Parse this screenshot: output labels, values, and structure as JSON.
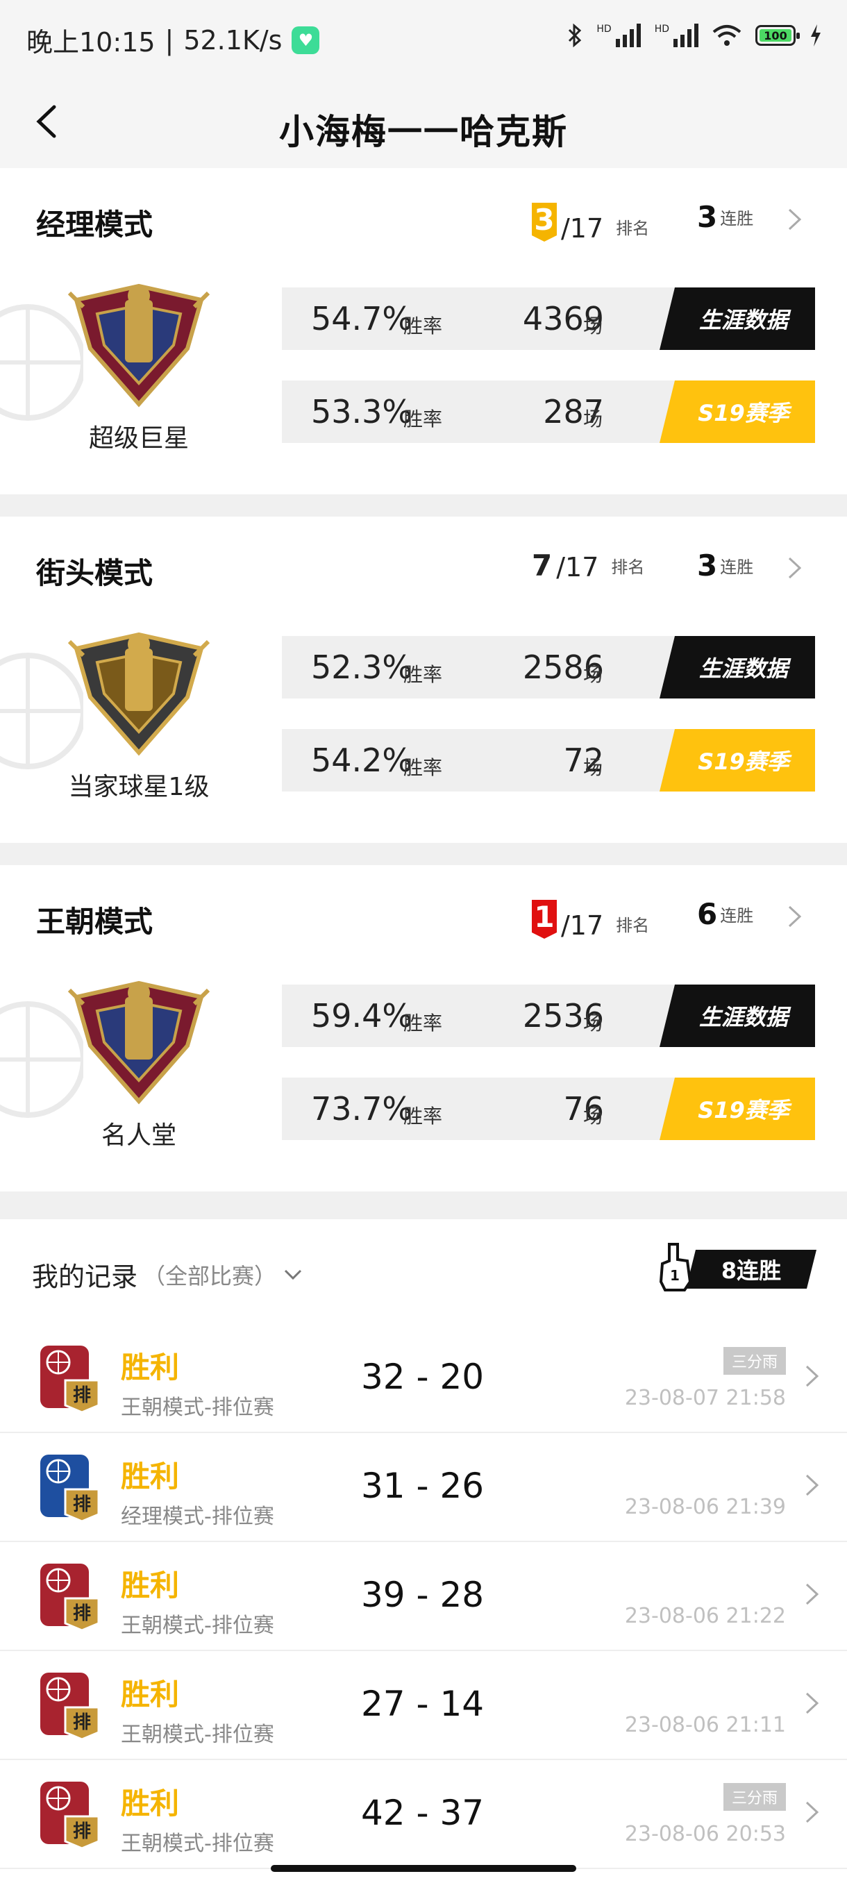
{
  "status_bar": {
    "time": "晚上10:15",
    "speed": "52.1K/s",
    "battery": "100"
  },
  "header": {
    "title": "小海梅一一哈克斯"
  },
  "modes": [
    {
      "title": "经理模式",
      "rank": "3",
      "rank_total": "/17",
      "rank_label": "排名",
      "rank_badge_color": "#f5b400",
      "streak": "3",
      "streak_label": "连胜",
      "emblem_name": "超级巨星",
      "rows": [
        {
          "pct": "54.7%",
          "pct_label": "胜率",
          "games": "4369",
          "games_label": "场",
          "tag": "生涯数据",
          "tag_style": "black"
        },
        {
          "pct": "53.3%",
          "pct_label": "胜率",
          "games": "287",
          "games_label": "场",
          "tag": "S19赛季",
          "tag_style": "yellow"
        }
      ]
    },
    {
      "title": "街头模式",
      "rank": "7",
      "rank_total": "/17",
      "rank_label": "排名",
      "rank_badge_color": "",
      "streak": "3",
      "streak_label": "连胜",
      "emblem_name": "当家球星1级",
      "rows": [
        {
          "pct": "52.3%",
          "pct_label": "胜率",
          "games": "2586",
          "games_label": "场",
          "tag": "生涯数据",
          "tag_style": "black"
        },
        {
          "pct": "54.2%",
          "pct_label": "胜率",
          "games": "72",
          "games_label": "场",
          "tag": "S19赛季",
          "tag_style": "yellow"
        }
      ]
    },
    {
      "title": "王朝模式",
      "rank": "1",
      "rank_total": "/17",
      "rank_label": "排名",
      "rank_badge_color": "#e01010",
      "streak": "6",
      "streak_label": "连胜",
      "emblem_name": "名人堂",
      "rows": [
        {
          "pct": "59.4%",
          "pct_label": "胜率",
          "games": "2536",
          "games_label": "场",
          "tag": "生涯数据",
          "tag_style": "black"
        },
        {
          "pct": "73.7%",
          "pct_label": "胜率",
          "games": "76",
          "games_label": "场",
          "tag": "S19赛季",
          "tag_style": "yellow"
        }
      ]
    }
  ],
  "records": {
    "title": "我的记录",
    "filter": "（全部比赛）",
    "streak_badge": "8连胜",
    "items": [
      {
        "result": "胜利",
        "mode": "王朝模式-排位赛",
        "score": "32 - 20",
        "tag": "三分雨",
        "time": "23-08-07 21:58",
        "icon": "dynasty-ranked-icon"
      },
      {
        "result": "胜利",
        "mode": "经理模式-排位赛",
        "score": "31 - 26",
        "tag": "",
        "time": "23-08-06 21:39",
        "icon": "manager-ranked-icon"
      },
      {
        "result": "胜利",
        "mode": "王朝模式-排位赛",
        "score": "39 - 28",
        "tag": "",
        "time": "23-08-06 21:22",
        "icon": "dynasty-ranked-icon"
      },
      {
        "result": "胜利",
        "mode": "王朝模式-排位赛",
        "score": "27 - 14",
        "tag": "",
        "time": "23-08-06 21:11",
        "icon": "dynasty-ranked-icon"
      },
      {
        "result": "胜利",
        "mode": "王朝模式-排位赛",
        "score": "42 - 37",
        "tag": "三分雨",
        "time": "23-08-06 20:53",
        "icon": "dynasty-ranked-icon"
      }
    ],
    "rank_icon_text": "排"
  },
  "colors": {
    "accent_yellow": "#ffc20e",
    "win_text": "#f5b400",
    "rank_red": "#e01010"
  }
}
